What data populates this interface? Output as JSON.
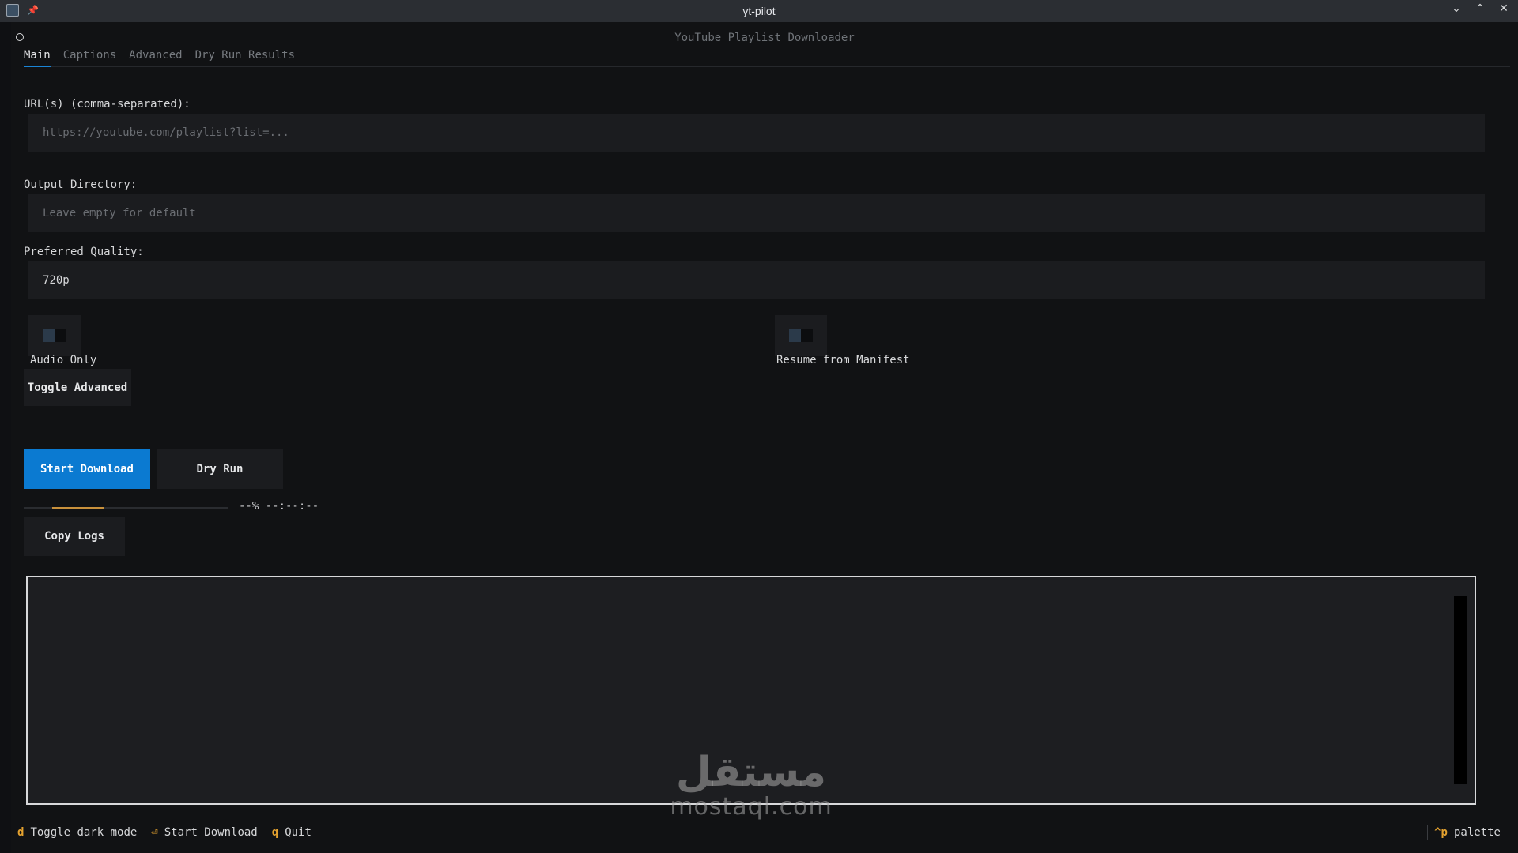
{
  "window": {
    "title": "yt-pilot",
    "controls": [
      "minimize",
      "maximize",
      "close"
    ]
  },
  "app": {
    "header": "YouTube Playlist Downloader"
  },
  "tabs": [
    {
      "label": "Main",
      "active": true
    },
    {
      "label": "Captions",
      "active": false
    },
    {
      "label": "Advanced",
      "active": false
    },
    {
      "label": "Dry Run Results",
      "active": false
    }
  ],
  "form": {
    "urls": {
      "label": "URL(s) (comma-separated):",
      "placeholder": "https://youtube.com/playlist?list=...",
      "value": ""
    },
    "output_dir": {
      "label": "Output Directory:",
      "placeholder": "Leave empty for default",
      "value": ""
    },
    "quality": {
      "label": "Preferred Quality:",
      "value": "720p"
    },
    "audio_only": {
      "label": "Audio Only",
      "checked": false
    },
    "resume": {
      "label": "Resume from Manifest",
      "checked": false
    }
  },
  "buttons": {
    "toggle_advanced": "Toggle Advanced",
    "start_download": "Start Download",
    "dry_run": "Dry Run",
    "copy_logs": "Copy Logs"
  },
  "progress": {
    "text": "--% --:--:--"
  },
  "footer": {
    "items": [
      {
        "key": "d",
        "label": "Toggle dark mode"
      },
      {
        "key": "⏎",
        "label": "Start Download"
      },
      {
        "key": "q",
        "label": "Quit"
      }
    ],
    "palette": {
      "key": "^p",
      "label": "palette"
    }
  },
  "watermark": {
    "arabic": "مستقل",
    "latin": "mostaql.com"
  },
  "colors": {
    "accent": "#0b7ad1",
    "key_highlight": "#e3a12f",
    "progress_fill": "#c9913c",
    "background": "#111214"
  }
}
